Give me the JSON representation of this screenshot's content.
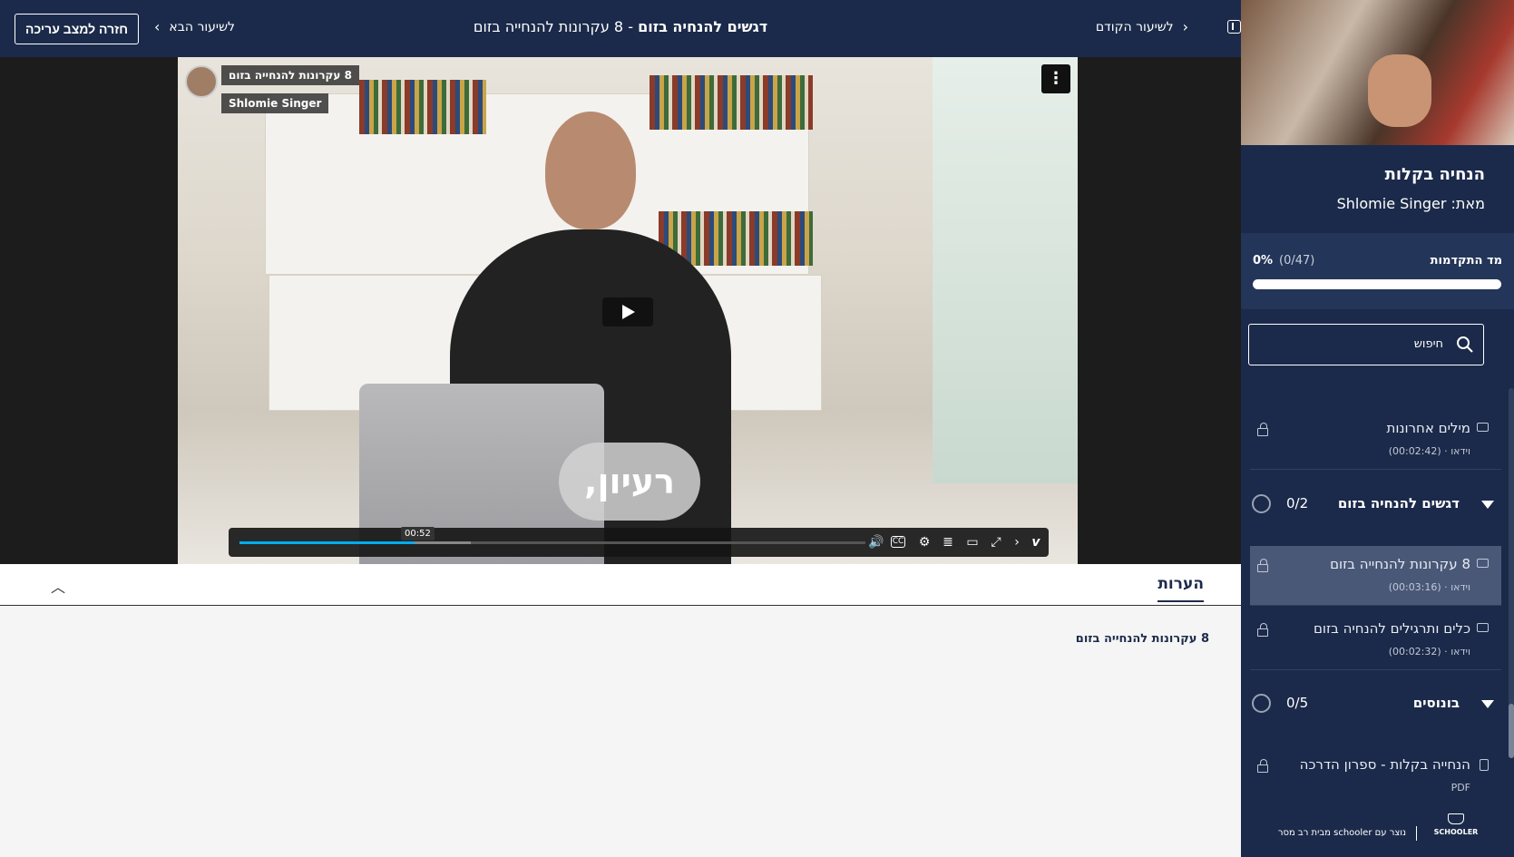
{
  "header": {
    "back_button": "חזרה למצב עריכה",
    "next_lesson": "לשיעור הבא",
    "prev_lesson": "לשיעור הקודם",
    "title_section": "דגשים להנחיה בזום",
    "title_sep": " - ",
    "title_lesson": "8 עקרונות להנחייה בזום"
  },
  "video": {
    "overlay_title": "8 עקרונות להנחייה בזום",
    "overlay_author": "Shlomie Singer",
    "caption": "רעיון,",
    "time_tooltip": "00:52",
    "progress": 0.28,
    "icons": [
      "volume-icon",
      "cc-icon",
      "settings-icon",
      "transcript-icon",
      "pip-icon",
      "fullscreen-icon",
      "chevron-icon",
      "vimeo-icon"
    ]
  },
  "notes": {
    "tab_label": "הערות",
    "content": "8 עקרונות להנחייה בזום"
  },
  "sidebar": {
    "course_title": "הנחיה בקלות",
    "course_author": "מאת: Shlomie Singer",
    "progress_label": "מד התקדמות",
    "progress_count": "(0/47)",
    "progress_pct": "0%",
    "search_placeholder": "חיפוש",
    "items": [
      {
        "title": "מילים אחרונות",
        "type": "וידאו",
        "duration": "(00:02:42)"
      },
      {
        "title": "8 עקרונות להנחייה בזום",
        "type": "וידאו",
        "duration": "(00:03:16)"
      },
      {
        "title": "כלים ותרגילים להנחיה בזום",
        "type": "וידאו",
        "duration": "(00:02:32)"
      },
      {
        "title": "הנחייה בקלות - ספרון הדרכה",
        "type": "PDF",
        "duration": ""
      }
    ],
    "sections": [
      {
        "title": "דגשים להנחיה בזום",
        "count": "0/2"
      },
      {
        "title": "בונוסים",
        "count": "0/5"
      }
    ],
    "footer_text": "נוצר עם schooler מבית רב מסר",
    "footer_logo": "SCHOOLER"
  },
  "colors": {
    "navy": "#1b2a4a",
    "accent": "#00adef"
  }
}
